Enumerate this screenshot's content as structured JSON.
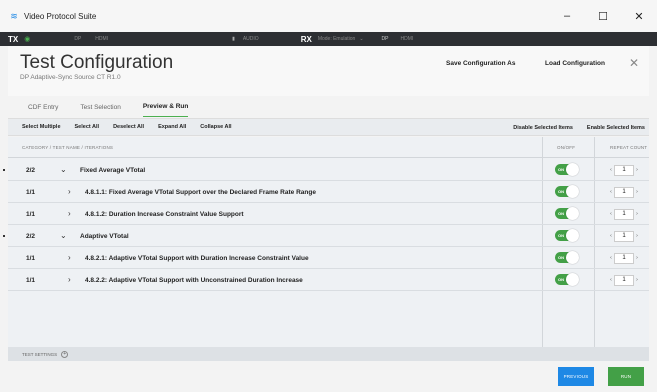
{
  "window": {
    "title": "Video Protocol Suite",
    "minimize": "–",
    "maximize": "☐",
    "close": "✕"
  },
  "strip": {
    "tx": "TX",
    "tx_dp": "DP",
    "tx_mode": "HDMI",
    "tx_audio": "AUDIO",
    "rx": "RX",
    "rx_mode": "Mode: Emulation",
    "rx_dp": "DP",
    "rx_hdmi": "HDMI"
  },
  "header": {
    "title": "Test Configuration",
    "subtitle": "DP Adaptive-Sync Source CT R1.0",
    "save_label": "Save Configuration As",
    "load_label": "Load Configuration",
    "close_label": "✕"
  },
  "tabs": [
    {
      "label": "CDF Entry"
    },
    {
      "label": "Test Selection"
    },
    {
      "label": "Preview & Run"
    }
  ],
  "toolbar": {
    "select_multiple": "Select Multiple",
    "select_all": "Select All",
    "deselect_all": "Deselect All",
    "expand_all": "Expand All",
    "collapse_all": "Collapse All",
    "disable_selected": "Disable Selected Items",
    "enable_selected": "Enable Selected Items"
  },
  "table": {
    "col_category": "CATEGORY / TEST NAME / ITERATIONS",
    "col_onoff": "ON/OFF",
    "col_repeat": "REPEAT COUNT",
    "rows": [
      {
        "count": "2/2",
        "chevron": "⌄",
        "label": "Fixed Average VTotal",
        "toggle": "ON",
        "repeat": "1"
      },
      {
        "count": "1/1",
        "chevron": "›",
        "label": "4.8.1.1: Fixed Average VTotal Support over the Declared Frame Rate Range",
        "toggle": "ON",
        "repeat": "1"
      },
      {
        "count": "1/1",
        "chevron": "›",
        "label": "4.8.1.2: Duration Increase Constraint Value Support",
        "toggle": "ON",
        "repeat": "1"
      },
      {
        "count": "2/2",
        "chevron": "⌄",
        "label": "Adaptive VTotal",
        "toggle": "ON",
        "repeat": "1"
      },
      {
        "count": "1/1",
        "chevron": "›",
        "label": "4.8.2.1: Adaptive VTotal Support with Duration Increase Constraint Value",
        "toggle": "ON",
        "repeat": "1"
      },
      {
        "count": "1/1",
        "chevron": "›",
        "label": "4.8.2.2: Adaptive VTotal Support with Unconstrained Duration Increase",
        "toggle": "ON",
        "repeat": "1"
      }
    ]
  },
  "footer": {
    "test_settings": "TEST SETTINGS",
    "previous": "PREVIOUS",
    "run": "RUN"
  },
  "colors": {
    "accent_green": "#43a047",
    "accent_blue": "#1e88e5",
    "dark_strip": "#2d2f33"
  }
}
